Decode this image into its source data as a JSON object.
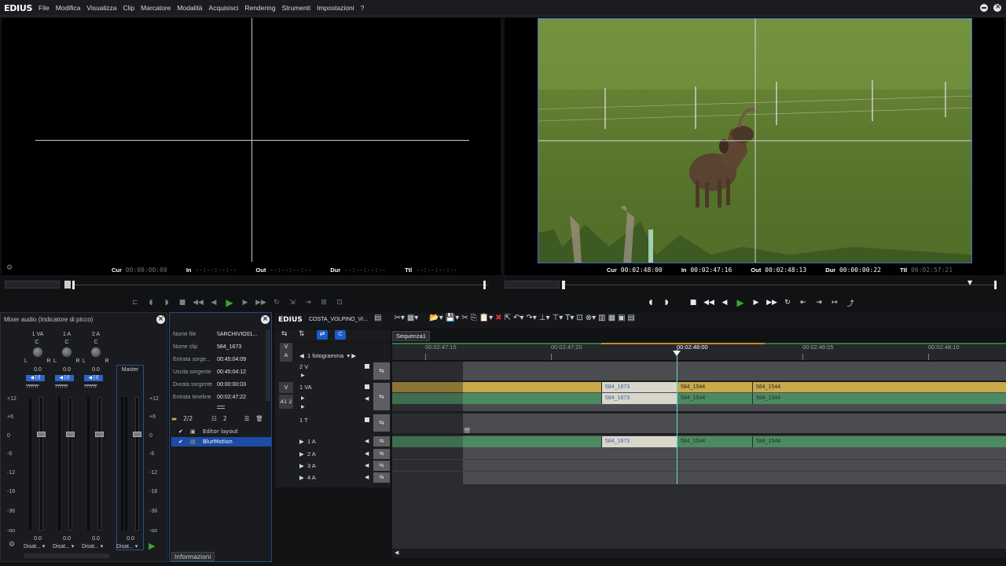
{
  "app": {
    "name": "EDIUS",
    "menu": [
      "File",
      "Modifica",
      "Visualizza",
      "Clip",
      "Marcatore",
      "Modalità",
      "Acquisisci",
      "Rendering",
      "Strumenti",
      "Impostazioni",
      "?"
    ]
  },
  "player": {
    "tc": {
      "cur_l": "Cur",
      "cur": "00:00:00:00",
      "in_l": "In",
      "in": "--:--:--:--",
      "out_l": "Out",
      "out": "--:--:--:--",
      "dur_l": "Dur",
      "dur": "--:--:--:--",
      "ttl_l": "Ttl",
      "ttl": "--:--:--:--"
    }
  },
  "recorder": {
    "tc": {
      "cur_l": "Cur",
      "cur": "00:02:48:00",
      "in_l": "In",
      "in": "00:02:47:16",
      "out_l": "Out",
      "out": "00:02:48:13",
      "dur_l": "Dur",
      "dur": "00:00:00:22",
      "ttl_l": "Ttl",
      "ttl": "00:02:57:21"
    }
  },
  "mixer": {
    "title": "Mixer audio (Indicatore di picco)",
    "channels": [
      {
        "name": "1 VA",
        "pan": "C",
        "value": "0.0",
        "bottom_value": "0.0",
        "mode": "Disat..."
      },
      {
        "name": "1 A",
        "pan": "C",
        "value": "0.0",
        "bottom_value": "0.0",
        "mode": "Disat..."
      },
      {
        "name": "2 A",
        "pan": "C",
        "value": "0.0",
        "bottom_value": "0.0",
        "mode": "Disat..."
      }
    ],
    "master": {
      "name": "Master",
      "bottom_value": "0.0",
      "mode": "Disat..."
    },
    "lr_l": "L",
    "lr_r": "R",
    "scale": [
      "+12",
      "+6",
      "0",
      "-6",
      "-12",
      "-18",
      "-36",
      "-oo"
    ]
  },
  "info": {
    "rows": [
      {
        "label": "Nome file",
        "value": "\\\\ARCHIVIO01..."
      },
      {
        "label": "Nome clip",
        "value": "584_1673"
      },
      {
        "label": "Entrata sorge...",
        "value": "00:45:04:09"
      },
      {
        "label": "Uscita sorgente",
        "value": "00:45:04:12"
      },
      {
        "label": "Durata sorgente",
        "value": "00:00:00:03"
      },
      {
        "label": "Entrata timeline",
        "value": "00:02:47:22"
      }
    ],
    "counter": "2/2",
    "count2": "2",
    "effects": [
      "Editor layout",
      "BlurMotion"
    ],
    "tab": "Informazioni"
  },
  "timeline": {
    "logo": "EDIUS",
    "project": "COSTA_VOLPINO_VI...",
    "sequence_tab": "Sequenza1",
    "scale_label": "1 fotogramma",
    "ruler": [
      "00:02:47:15",
      "00:02:47:20",
      "00:02:48:00",
      "00:02:48:05",
      "00:02:48:10"
    ],
    "tracks": {
      "v2": "2 V",
      "va1": "1 VA",
      "t1": "1 T",
      "a1": "1 A",
      "a2": "2 A",
      "a3": "3 A",
      "a4": "4 A",
      "v_label": "V",
      "a_label": "A",
      "a12_label": "A1 2"
    },
    "clips": {
      "c1": "584_1673",
      "c2": "584_1544",
      "c3": "584_1544"
    }
  },
  "colors": {
    "accent": "#2f6fd6",
    "video_clip": "#c9a94a",
    "audio_clip": "#4c8b62",
    "play": "#36a534"
  }
}
